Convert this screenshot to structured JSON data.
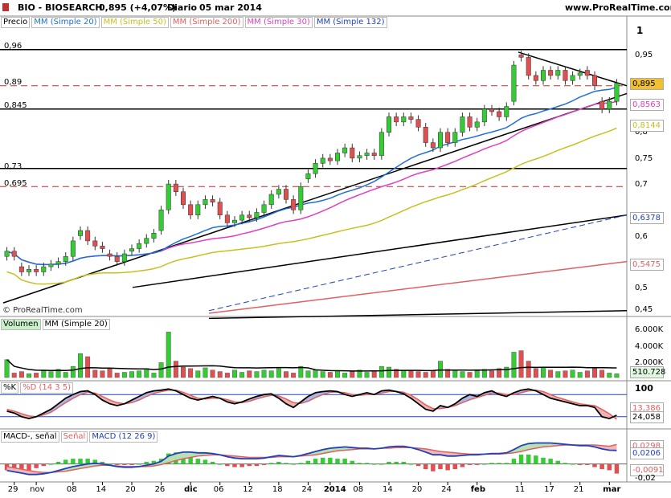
{
  "header": {
    "ticker": "BIO - BIOSEARCH",
    "price_change": "0,895 (+4,07%)",
    "period": "Diario",
    "date": "05 mar 2014",
    "site": "www.ProRealTime.com"
  },
  "legends": {
    "price": [
      "Precio",
      "MM (Simple 20)",
      "MM (Simple 50)",
      "MM (Simple 200)",
      "MM (Simple 30)",
      "MM (Simple 132)"
    ],
    "volume": [
      "Volumen",
      "MM (Simple 20)"
    ],
    "stoch": [
      "%K",
      "%D (14 3 5)"
    ],
    "macd": [
      "MACD-, señal",
      "Señal",
      "MACD (12 26 9)"
    ]
  },
  "colors": {
    "up": "#33cc33",
    "down": "#e05050",
    "mm20": "#1e6fd9",
    "mm50": "#c8c020",
    "mm200": "#e06060",
    "mm30": "#e040c0",
    "mm132": "#2040c0"
  },
  "watermark": "© ProRealTime.com",
  "hlines": [
    "0,96",
    "0,89",
    "0,845",
    "0,73",
    "0,695"
  ],
  "price_axis": [
    "1",
    "0,95",
    "0,9",
    "0,85",
    "0,8",
    "0,75",
    "0,7",
    "0,65",
    "0,6",
    "0,55",
    "0,5",
    "0,45"
  ],
  "price_tags": [
    "0,895",
    "0,8563",
    "0,8144",
    "0,6378",
    "0,5475"
  ],
  "volume_axis": [
    "6.000K",
    "4.000K",
    "2.000K"
  ],
  "volume_tag": "510.728",
  "stoch_axis": [
    "100"
  ],
  "stoch_tags": [
    "13,386",
    "24,058"
  ],
  "macd_tags": [
    "0,0298",
    "0,0206",
    "-0,0091"
  ],
  "macd_axis": [
    "-0,02"
  ],
  "x_labels": [
    "29",
    "nov",
    "08",
    "14",
    "20",
    "26",
    "dic",
    "06",
    "12",
    "18",
    "24",
    "2014",
    "08",
    "14",
    "20",
    "24",
    "feb",
    "11",
    "17",
    "21",
    "mar"
  ],
  "chart_data": {
    "type": "candlestick",
    "title": "BIO - BIOSEARCH",
    "ylim": [
      0.43,
      1.0
    ],
    "candles": [
      {
        "o": 0.56,
        "c": 0.57
      },
      {
        "o": 0.57,
        "c": 0.56
      },
      {
        "o": 0.54,
        "c": 0.53
      },
      {
        "o": 0.53,
        "c": 0.535
      },
      {
        "o": 0.535,
        "c": 0.53
      },
      {
        "o": 0.53,
        "c": 0.54
      },
      {
        "o": 0.54,
        "c": 0.545
      },
      {
        "o": 0.545,
        "c": 0.55
      },
      {
        "o": 0.55,
        "c": 0.56
      },
      {
        "o": 0.56,
        "c": 0.59
      },
      {
        "o": 0.6,
        "c": 0.61
      },
      {
        "o": 0.61,
        "c": 0.59
      },
      {
        "o": 0.59,
        "c": 0.58
      },
      {
        "o": 0.58,
        "c": 0.575
      },
      {
        "o": 0.565,
        "c": 0.56
      },
      {
        "o": 0.56,
        "c": 0.55
      },
      {
        "o": 0.55,
        "c": 0.565
      },
      {
        "o": 0.57,
        "c": 0.575
      },
      {
        "o": 0.575,
        "c": 0.585
      },
      {
        "o": 0.585,
        "c": 0.595
      },
      {
        "o": 0.595,
        "c": 0.605
      },
      {
        "o": 0.61,
        "c": 0.65
      },
      {
        "o": 0.65,
        "c": 0.7
      },
      {
        "o": 0.7,
        "c": 0.685
      },
      {
        "o": 0.685,
        "c": 0.66
      },
      {
        "o": 0.66,
        "c": 0.64
      },
      {
        "o": 0.64,
        "c": 0.66
      },
      {
        "o": 0.66,
        "c": 0.67
      },
      {
        "o": 0.67,
        "c": 0.665
      },
      {
        "o": 0.665,
        "c": 0.64
      },
      {
        "o": 0.64,
        "c": 0.625
      },
      {
        "o": 0.625,
        "c": 0.63
      },
      {
        "o": 0.63,
        "c": 0.64
      },
      {
        "o": 0.64,
        "c": 0.635
      },
      {
        "o": 0.635,
        "c": 0.645
      },
      {
        "o": 0.645,
        "c": 0.66
      },
      {
        "o": 0.66,
        "c": 0.68
      },
      {
        "o": 0.68,
        "c": 0.69
      },
      {
        "o": 0.69,
        "c": 0.67
      },
      {
        "o": 0.67,
        "c": 0.65
      },
      {
        "o": 0.65,
        "c": 0.695
      },
      {
        "o": 0.71,
        "c": 0.72
      },
      {
        "o": 0.72,
        "c": 0.74
      },
      {
        "o": 0.74,
        "c": 0.75
      },
      {
        "o": 0.75,
        "c": 0.745
      },
      {
        "o": 0.745,
        "c": 0.76
      },
      {
        "o": 0.76,
        "c": 0.77
      },
      {
        "o": 0.77,
        "c": 0.75
      },
      {
        "o": 0.75,
        "c": 0.755
      },
      {
        "o": 0.755,
        "c": 0.76
      },
      {
        "o": 0.76,
        "c": 0.755
      },
      {
        "o": 0.755,
        "c": 0.8
      },
      {
        "o": 0.8,
        "c": 0.83
      },
      {
        "o": 0.83,
        "c": 0.82
      },
      {
        "o": 0.82,
        "c": 0.83
      },
      {
        "o": 0.83,
        "c": 0.825
      },
      {
        "o": 0.825,
        "c": 0.81
      },
      {
        "o": 0.81,
        "c": 0.78
      },
      {
        "o": 0.78,
        "c": 0.77
      },
      {
        "o": 0.77,
        "c": 0.8
      },
      {
        "o": 0.8,
        "c": 0.78
      },
      {
        "o": 0.78,
        "c": 0.8
      },
      {
        "o": 0.8,
        "c": 0.83
      },
      {
        "o": 0.83,
        "c": 0.81
      },
      {
        "o": 0.81,
        "c": 0.82
      },
      {
        "o": 0.82,
        "c": 0.845
      },
      {
        "o": 0.845,
        "c": 0.84
      },
      {
        "o": 0.84,
        "c": 0.83
      },
      {
        "o": 0.83,
        "c": 0.85
      },
      {
        "o": 0.86,
        "c": 0.93
      },
      {
        "o": 0.95,
        "c": 0.945
      },
      {
        "o": 0.945,
        "c": 0.91
      },
      {
        "o": 0.91,
        "c": 0.9
      },
      {
        "o": 0.9,
        "c": 0.92
      },
      {
        "o": 0.92,
        "c": 0.91
      },
      {
        "o": 0.91,
        "c": 0.92
      },
      {
        "o": 0.92,
        "c": 0.9
      },
      {
        "o": 0.9,
        "c": 0.91
      },
      {
        "o": 0.91,
        "c": 0.915
      },
      {
        "o": 0.92,
        "c": 0.91
      },
      {
        "o": 0.91,
        "c": 0.89
      },
      {
        "o": 0.86,
        "c": 0.845
      },
      {
        "o": 0.845,
        "c": 0.86
      },
      {
        "o": 0.86,
        "c": 0.895
      }
    ],
    "volume": [
      2.4,
      0.6,
      0.8,
      0.5,
      0.6,
      0.9,
      0.8,
      1.1,
      0.7,
      1.5,
      3.2,
      2.8,
      1.0,
      0.9,
      1.2,
      0.6,
      0.7,
      0.8,
      0.9,
      1.2,
      0.6,
      2.0,
      6.1,
      2.2,
      1.4,
      1.2,
      0.9,
      1.3,
      1.0,
      0.8,
      0.6,
      1.0,
      0.7,
      0.9,
      0.8,
      1.0,
      0.9,
      1.2,
      0.8,
      0.6,
      1.5,
      0.9,
      1.0,
      0.8,
      0.7,
      0.9,
      0.6,
      0.8,
      1.0,
      0.7,
      0.9,
      1.5,
      1.4,
      1.1,
      0.9,
      1.0,
      0.8,
      0.7,
      0.9,
      2.2,
      1.1,
      1.0,
      0.8,
      0.7,
      0.9,
      1.1,
      0.9,
      1.2,
      1.4,
      3.4,
      3.6,
      2.2,
      1.2,
      1.4,
      1.0,
      0.8,
      0.9,
      1.0,
      0.7,
      0.9,
      1.2,
      1.0,
      0.6,
      0.5
    ],
    "volume_ylim": [
      0,
      7
    ],
    "stoch_k": [
      35,
      30,
      20,
      15,
      20,
      30,
      40,
      55,
      70,
      80,
      88,
      90,
      80,
      65,
      55,
      50,
      55,
      65,
      75,
      85,
      90,
      92,
      95,
      90,
      80,
      70,
      65,
      70,
      75,
      70,
      60,
      55,
      60,
      68,
      75,
      80,
      82,
      70,
      55,
      45,
      60,
      75,
      85,
      88,
      90,
      88,
      80,
      75,
      80,
      85,
      80,
      90,
      92,
      88,
      82,
      70,
      55,
      40,
      35,
      50,
      45,
      55,
      70,
      80,
      75,
      85,
      90,
      80,
      75,
      85,
      92,
      95,
      90,
      80,
      70,
      65,
      60,
      55,
      50,
      50,
      45,
      20,
      15,
      24
    ],
    "stoch_d": [
      40,
      35,
      28,
      22,
      20,
      25,
      32,
      45,
      58,
      70,
      80,
      86,
      84,
      75,
      65,
      58,
      55,
      58,
      65,
      75,
      83,
      88,
      92,
      92,
      86,
      78,
      70,
      68,
      70,
      70,
      66,
      60,
      58,
      62,
      68,
      74,
      78,
      76,
      68,
      58,
      56,
      62,
      72,
      80,
      86,
      87,
      85,
      80,
      78,
      80,
      81,
      84,
      88,
      89,
      86,
      78,
      66,
      52,
      42,
      42,
      45,
      50,
      58,
      66,
      72,
      78,
      84,
      84,
      80,
      80,
      85,
      90,
      92,
      88,
      80,
      72,
      66,
      60,
      55,
      52,
      50,
      40,
      28,
      13
    ],
    "stoch_ylim": [
      0,
      100
    ],
    "macd": [
      -0.01,
      -0.012,
      -0.014,
      -0.016,
      -0.016,
      -0.015,
      -0.013,
      -0.01,
      -0.007,
      -0.004,
      -0.002,
      0.0,
      0.001,
      0.0,
      -0.002,
      -0.004,
      -0.005,
      -0.005,
      -0.004,
      -0.002,
      0.0,
      0.004,
      0.012,
      0.016,
      0.018,
      0.018,
      0.017,
      0.017,
      0.016,
      0.014,
      0.011,
      0.009,
      0.008,
      0.008,
      0.008,
      0.009,
      0.011,
      0.013,
      0.012,
      0.011,
      0.013,
      0.016,
      0.019,
      0.022,
      0.024,
      0.025,
      0.026,
      0.025,
      0.024,
      0.024,
      0.023,
      0.024,
      0.026,
      0.027,
      0.027,
      0.025,
      0.022,
      0.018,
      0.014,
      0.014,
      0.012,
      0.012,
      0.013,
      0.014,
      0.014,
      0.015,
      0.016,
      0.016,
      0.017,
      0.022,
      0.028,
      0.031,
      0.032,
      0.032,
      0.032,
      0.031,
      0.03,
      0.029,
      0.028,
      0.028,
      0.026,
      0.023,
      0.021,
      0.0206
    ],
    "signal": [
      -0.004,
      -0.006,
      -0.008,
      -0.01,
      -0.012,
      -0.013,
      -0.013,
      -0.012,
      -0.011,
      -0.009,
      -0.007,
      -0.005,
      -0.003,
      -0.002,
      -0.002,
      -0.003,
      -0.004,
      -0.004,
      -0.004,
      -0.004,
      -0.003,
      -0.001,
      0.002,
      0.005,
      0.008,
      0.01,
      0.012,
      0.013,
      0.014,
      0.014,
      0.013,
      0.012,
      0.011,
      0.01,
      0.01,
      0.01,
      0.01,
      0.011,
      0.011,
      0.011,
      0.012,
      0.013,
      0.014,
      0.016,
      0.018,
      0.02,
      0.021,
      0.022,
      0.023,
      0.023,
      0.023,
      0.024,
      0.024,
      0.025,
      0.025,
      0.025,
      0.024,
      0.023,
      0.021,
      0.019,
      0.018,
      0.017,
      0.016,
      0.015,
      0.015,
      0.015,
      0.015,
      0.015,
      0.016,
      0.017,
      0.019,
      0.022,
      0.024,
      0.026,
      0.027,
      0.028,
      0.029,
      0.029,
      0.029,
      0.029,
      0.029,
      0.028,
      0.027,
      0.0298
    ],
    "macd_ylim": [
      -0.025,
      0.04
    ],
    "x_tick_index": [
      1,
      4,
      9,
      13,
      17,
      21,
      25,
      29,
      33,
      37,
      41,
      44,
      48,
      52,
      56,
      60,
      64,
      70,
      74,
      78,
      82
    ]
  }
}
